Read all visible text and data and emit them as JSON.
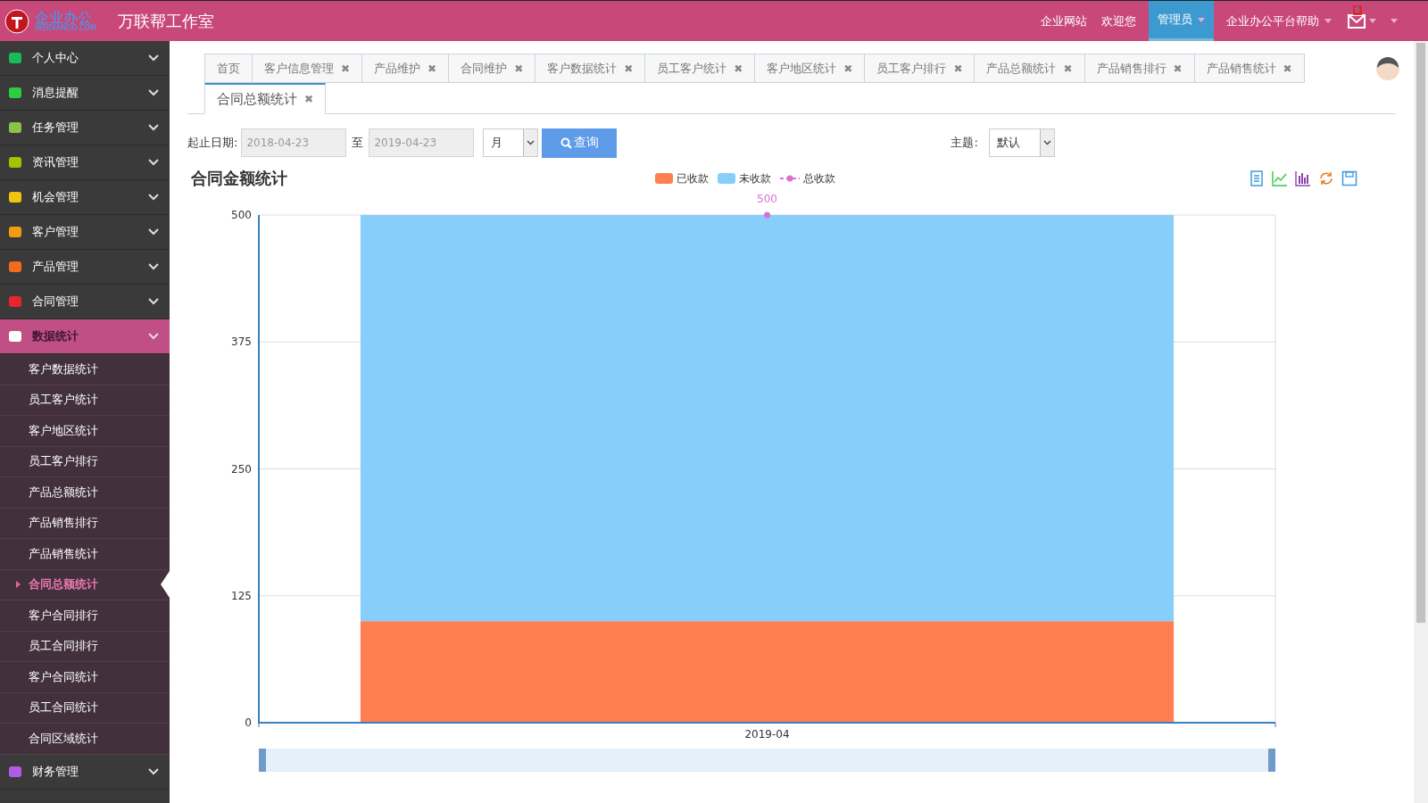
{
  "header": {
    "logo_text": "企业办公",
    "logo_sub": "WEIDIANGO.COM",
    "title": "万联帮工作室",
    "nav": [
      {
        "label": "企业网站",
        "selected": false,
        "dropdown": false
      },
      {
        "label": "欢迎您",
        "selected": false,
        "dropdown": false
      },
      {
        "label": "管理员",
        "selected": true,
        "dropdown": true
      },
      {
        "label": "企业办公平台帮助",
        "selected": false,
        "dropdown": true
      }
    ],
    "mail_badge": "6"
  },
  "sidebar": {
    "items": [
      {
        "label": "个人中心",
        "selected": false
      },
      {
        "label": "消息提醒",
        "selected": false
      },
      {
        "label": "任务管理",
        "selected": false
      },
      {
        "label": "资讯管理",
        "selected": false
      },
      {
        "label": "机会管理",
        "selected": false
      },
      {
        "label": "客户管理",
        "selected": false
      },
      {
        "label": "产品管理",
        "selected": false
      },
      {
        "label": "合同管理",
        "selected": false
      },
      {
        "label": "数据统计",
        "selected": true,
        "children": [
          {
            "label": "客户数据统计",
            "selected": false
          },
          {
            "label": "员工客户统计",
            "selected": false
          },
          {
            "label": "客户地区统计",
            "selected": false
          },
          {
            "label": "员工客户排行",
            "selected": false
          },
          {
            "label": "产品总额统计",
            "selected": false
          },
          {
            "label": "产品销售排行",
            "selected": false
          },
          {
            "label": "产品销售统计",
            "selected": false
          },
          {
            "label": "合同总额统计",
            "selected": true
          },
          {
            "label": "客户合同排行",
            "selected": false
          },
          {
            "label": "员工合同排行",
            "selected": false
          },
          {
            "label": "客户合同统计",
            "selected": false
          },
          {
            "label": "员工合同统计",
            "selected": false
          },
          {
            "label": "合同区域统计",
            "selected": false
          }
        ]
      },
      {
        "label": "财务管理",
        "selected": false
      }
    ]
  },
  "tabs": [
    {
      "label": "首页",
      "selected": false
    },
    {
      "label": "客户信息管理",
      "selected": false,
      "close": "✖"
    },
    {
      "label": "产品维护",
      "selected": false,
      "close": "✖"
    },
    {
      "label": "合同维护",
      "selected": false,
      "close": "✖"
    },
    {
      "label": "客户数据统计",
      "selected": false,
      "close": "✖"
    },
    {
      "label": "员工客户统计",
      "selected": false,
      "close": "✖"
    },
    {
      "label": "客户地区统计",
      "selected": false,
      "close": "✖"
    },
    {
      "label": "员工客户排行",
      "selected": false,
      "close": "✖"
    },
    {
      "label": "产品总额统计",
      "selected": false,
      "close": "✖"
    },
    {
      "label": "产品销售排行",
      "selected": false,
      "close": "✖"
    },
    {
      "label": "产品销售统计",
      "selected": false,
      "close": "✖"
    },
    {
      "label": "合同总额统计",
      "selected": true,
      "close": "✖"
    }
  ],
  "filters": {
    "date_label": "起止日期:",
    "start": "2018-04-23",
    "to": "至",
    "end": "2019-04-23",
    "period": "月",
    "query_button": "查询",
    "theme_label": "主题:",
    "theme": "默认"
  },
  "chart_data": {
    "type": "bar",
    "title": "合同金额统计",
    "categories": [
      "2019-04"
    ],
    "stacked": true,
    "grid": true,
    "ylim": [
      0,
      500
    ],
    "yticks": [
      0,
      125,
      250,
      375,
      500
    ],
    "series": [
      {
        "name": "已收款",
        "color": "#ff7f50",
        "type": "bar",
        "values": [
          100
        ]
      },
      {
        "name": "未收款",
        "color": "#87cefa",
        "type": "bar",
        "values": [
          400
        ]
      },
      {
        "name": "总收款",
        "color": "#da70d6",
        "type": "line",
        "marker": "circle",
        "values": [
          500
        ],
        "data_labels": true
      }
    ]
  }
}
